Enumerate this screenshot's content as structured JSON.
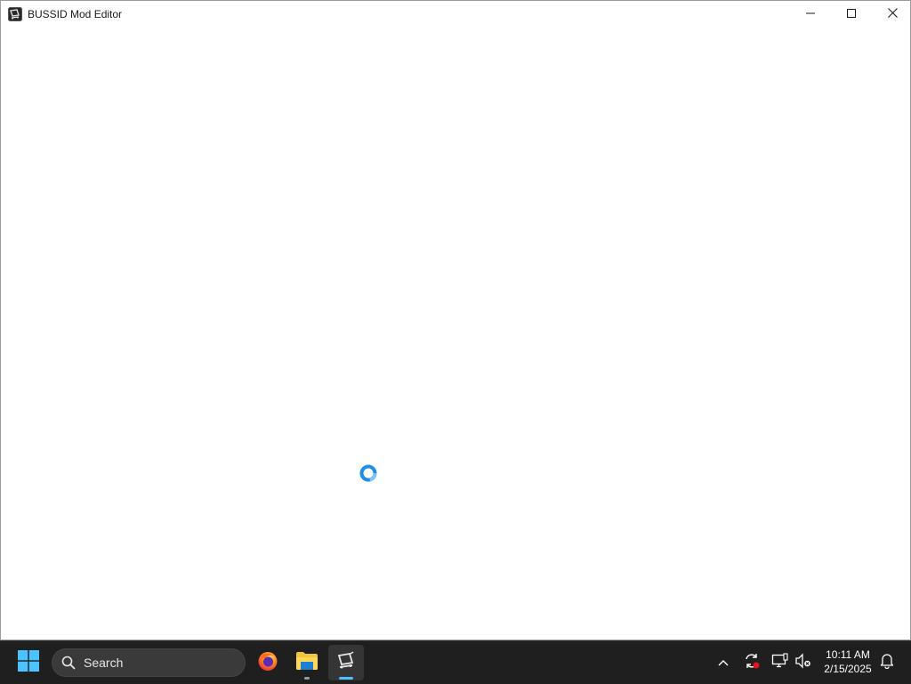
{
  "window": {
    "title": "BUSSID Mod Editor",
    "app_icon": "bussid-app-icon",
    "controls": [
      "minimize-icon",
      "maximize-icon",
      "close-icon"
    ]
  },
  "content": {
    "state_indicator": "loading-spinner-icon",
    "spinner_color": "#1f8fe6"
  },
  "taskbar": {
    "start_icon": "windows-start-icon",
    "search": {
      "placeholder": "Search",
      "icon": "search-icon"
    },
    "apps": [
      {
        "name": "firefox",
        "icon": "firefox-icon",
        "active": false
      },
      {
        "name": "file-explorer",
        "icon": "folder-icon",
        "active": false,
        "running": true
      },
      {
        "name": "bussid-mod-editor",
        "icon": "bussid-app-icon",
        "active": true
      }
    ],
    "tray": {
      "icons": [
        "chevron-up-icon",
        "sync-icon",
        "network-icon",
        "volume-muted-icon",
        "notification-bell-icon"
      ],
      "time": "10:11 AM",
      "date": "2/15/2025"
    },
    "accent_color": "#4cc2ff"
  }
}
